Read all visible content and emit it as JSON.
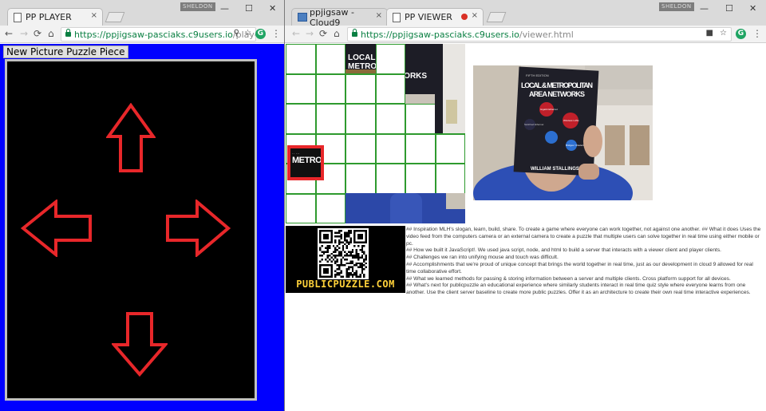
{
  "left_window": {
    "tab": {
      "title": "PP PLAYER",
      "close": "×"
    },
    "user_badge": "SHELDON",
    "controls": {
      "minimize": "—",
      "maximize": "☐",
      "close": "✕"
    },
    "nav": {
      "back": "←",
      "forward": "→",
      "reload": "⟳",
      "home": "⌂"
    },
    "address": {
      "host": "https://ppjigsaw-pasciaks.c9users.io",
      "path": "/player.html"
    },
    "toolbar_icons": {
      "zoom": "⚲",
      "star": "☆",
      "extension": "G",
      "menu": "⋮"
    },
    "page": {
      "button_label": "New Picture Puzzle Piece",
      "arrows": [
        "up",
        "left",
        "right",
        "down"
      ],
      "arrow_color": "#e8272a",
      "background_color": "#0000ff"
    }
  },
  "right_window": {
    "tabs": [
      {
        "title": "ppjigsaw - Cloud9",
        "close": "×"
      },
      {
        "title": "PP VIEWER",
        "close": "×"
      }
    ],
    "user_badge": "SHELDON",
    "controls": {
      "minimize": "—",
      "maximize": "☐",
      "close": "✕"
    },
    "nav": {
      "back": "←",
      "forward": "→",
      "reload": "⟳",
      "home": "⌂"
    },
    "address": {
      "host": "https://ppjigsaw-pasciaks.c9users.io",
      "path": "/viewer.html"
    },
    "toolbar_icons": {
      "camera": "■",
      "star": "☆",
      "extension": "G",
      "menu": "⋮"
    },
    "page": {
      "grid": {
        "rows": 6,
        "cols": 6,
        "line_color": "#2e9a2e"
      },
      "book": {
        "edition": "FIFTH EDITION",
        "title_line1": "LOCAL & METROPOLITAN",
        "title_line2": "AREA NETWORKS",
        "label_1": "Gigabit Ethernet",
        "label_2": "Switched Ethernet",
        "label_3": "Wireless LANs",
        "label_4": "Bridges / Routers",
        "author": "WILLIAM STALLINGS"
      },
      "qr_caption": "PUBLICPUZZLE.COM",
      "description": [
        "## Inspiration MLH's slogan, learn, build, share. To create a game where everyone can work together, not against one another. ## What it does Uses the video feed from the computers camera or an external camera to create a puzzle that multiple users can solve together in real time using either mobile or pc.",
        "## How we built it JavaScript!. We used java script, node, and html to build a server that interacts with a viewer client and player clients.",
        "## Challenges we ran into unifying mouse and touch was difficult.",
        "## Accomplishments that we're proud of unique concept that brings the world together in real time, just as our development in cloud 9 allowed for real time collaborative effort.",
        "## What we learned methods for passing & storing information between a server and multiple clients. Cross platform support for all devices.",
        "## What's next for publicpuzzle an educational experience where similarly students interact in real time quiz style where everyone learns from one another. Use the client server baseline to create more public puzzles. Offer it as an architecture to create their own real time interactive experiences."
      ]
    }
  }
}
